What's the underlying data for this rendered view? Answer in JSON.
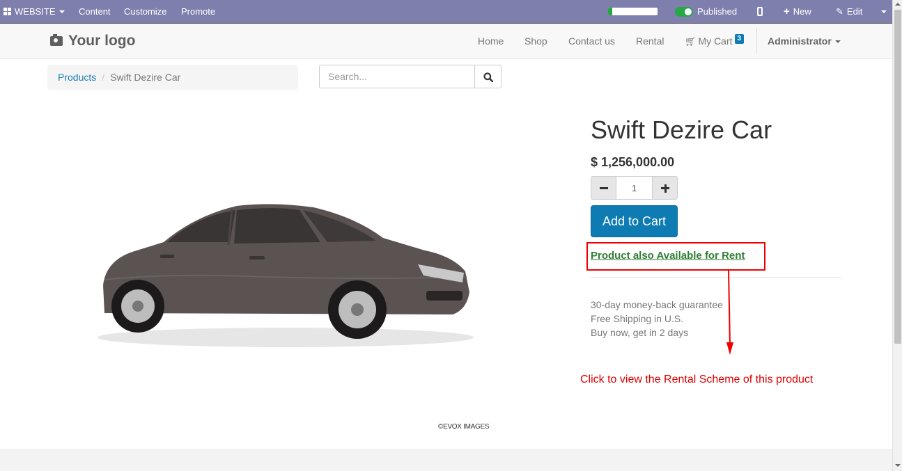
{
  "admin_bar": {
    "website_label": "WEBSITE",
    "menu": [
      "Content",
      "Customize",
      "Promote"
    ],
    "progress_fraction": 0.08,
    "published_label": "Published",
    "new_label": "New",
    "edit_label": "Edit"
  },
  "navbar": {
    "logo_text": "Your logo",
    "links": [
      "Home",
      "Shop",
      "Contact us",
      "Rental"
    ],
    "cart_label": "My Cart",
    "cart_count": "3",
    "user_label": "Administrator"
  },
  "breadcrumb": {
    "parent": "Products",
    "current": "Swift Dezire Car"
  },
  "search": {
    "placeholder": "Search..."
  },
  "product": {
    "name": "Swift Dezire Car",
    "price": "$ 1,256,000.00",
    "quantity": "1",
    "add_to_cart_label": "Add to Cart",
    "rent_link_label": "Product also Available for Rent",
    "terms": [
      "30-day money-back guarantee",
      "Free Shipping in U.S.",
      "Buy now, get in 2 days"
    ],
    "image_credit": "©EVOX IMAGES"
  },
  "annotation": {
    "text": "Click to view the Rental Scheme of this product"
  },
  "colors": {
    "admin_bar": "#7f7fae",
    "primary": "#0f7bb3",
    "rent_link": "#2e7d32",
    "annotation": "#dd0000"
  }
}
